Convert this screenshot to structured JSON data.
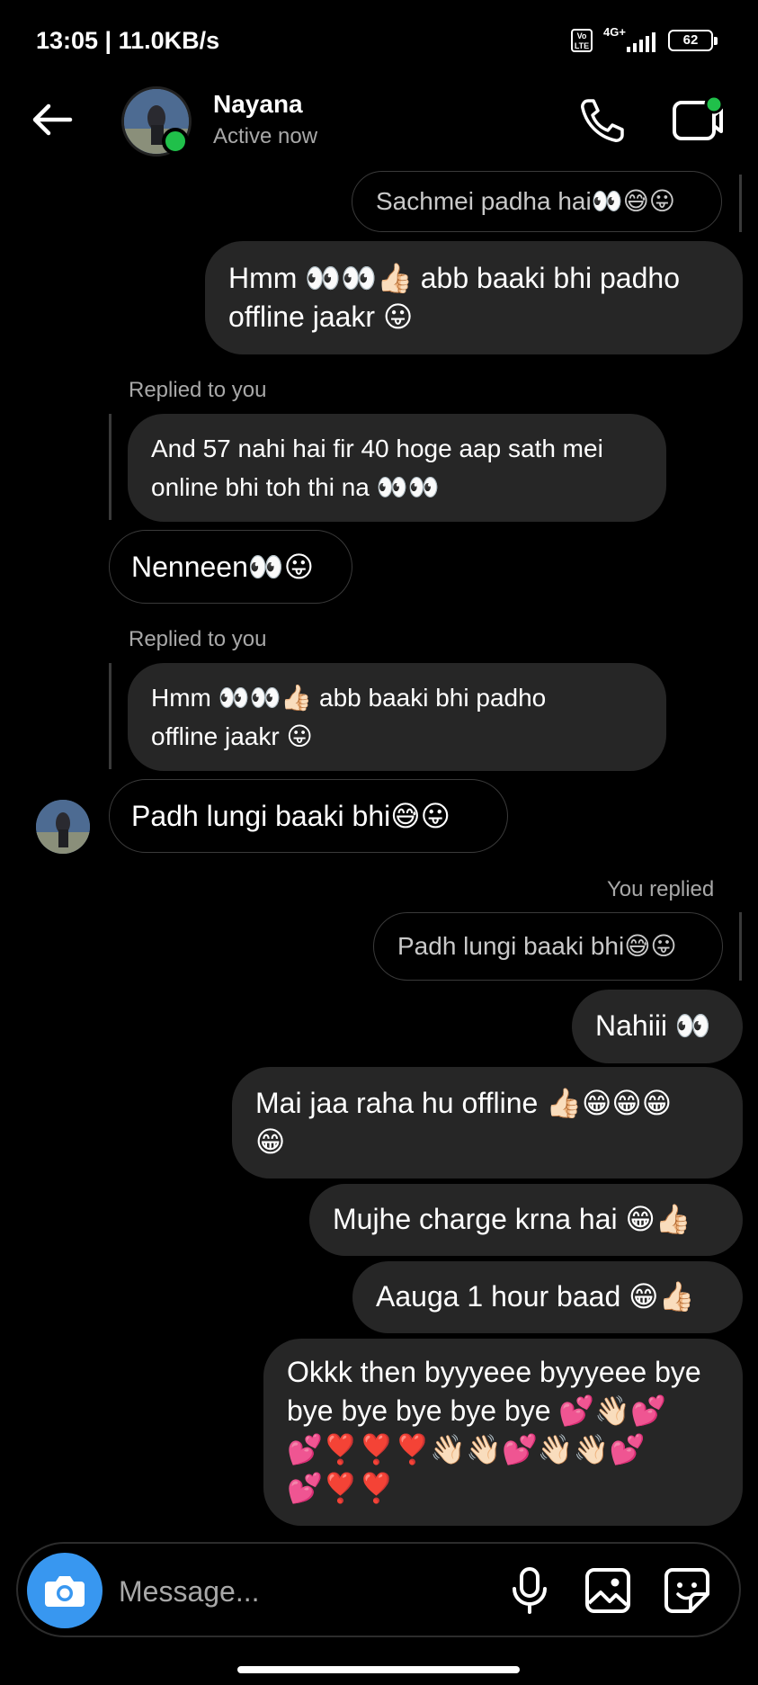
{
  "status_bar": {
    "time_speed": "13:05 | 11.0KB/s",
    "volte": "Vo LTE",
    "network": "4G+",
    "battery": "62"
  },
  "header": {
    "name": "Nayana",
    "status": "Active now"
  },
  "messages": {
    "m1": "Sachmei padha hai👀😅😛",
    "m2": "Hmm 👀👀👍🏻 abb baaki bhi padho\noffline jaakr 😛",
    "m3_meta": "Replied to you",
    "m3_quote": "And 57 nahi hai fir 40 hoge aap sath mei\nonline bhi toh thi na 👀👀",
    "m3_reply": "Nenneen👀😛",
    "m4_meta": "Replied to you",
    "m4_quote": "Hmm 👀👀👍🏻 abb baaki bhi padho\noffline jaakr 😛",
    "m4_reply": "Padh lungi baaki bhi😅😛",
    "m5_meta": "You replied",
    "m5_preview": "Padh lungi baaki bhi😅😛",
    "m5_reply": "Nahiii 👀",
    "m6": "Mai jaa raha hu offline 👍🏻😁😁😁\n😁",
    "m7": "Mujhe charge krna hai 😁👍🏻",
    "m8": "Aauga 1 hour baad 😁👍🏻",
    "m9": "Okkk then byyyeee byyyeee bye\nbye bye bye bye bye 💕👋🏻💕\n💕❣️❣️❣️👋🏻👋🏻💕👋🏻👋🏻💕\n💕❣️❣️"
  },
  "composer": {
    "placeholder": "Message..."
  },
  "colors": {
    "background": "#000000",
    "bubble_mine": "#262626",
    "active_green": "#20c04a",
    "camera_blue": "#3897f0",
    "muted_text": "#a8a8a8"
  },
  "icons": [
    "back-arrow-icon",
    "phone-icon",
    "video-camera-icon",
    "camera-icon",
    "microphone-icon",
    "gallery-icon",
    "sticker-icon"
  ]
}
